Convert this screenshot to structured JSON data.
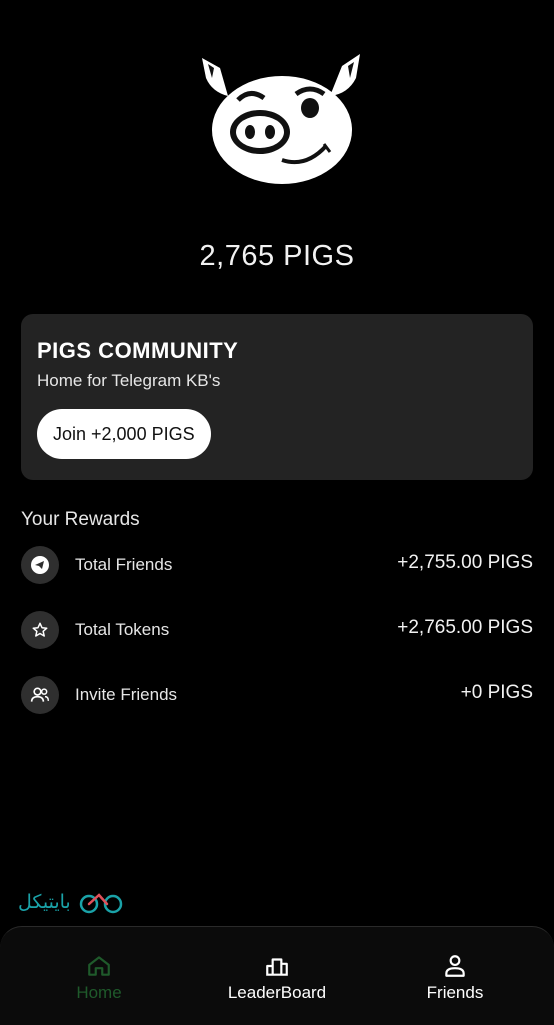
{
  "balance": "2,765 PIGS",
  "community": {
    "title": "PIGS COMMUNITY",
    "subtitle": "Home for Telegram KB's",
    "join_label": "Join +2,000 PIGS"
  },
  "rewards": {
    "title": "Your Rewards",
    "items": [
      {
        "label": "Total Friends",
        "value": "+2,755.00 PIGS",
        "icon": "telegram-icon"
      },
      {
        "label": "Total Tokens",
        "value": "+2,765.00 PIGS",
        "icon": "star-icon"
      },
      {
        "label": "Invite Friends",
        "value": "+0 PIGS",
        "icon": "users-icon"
      }
    ]
  },
  "watermark": {
    "text": "بایتیکل"
  },
  "nav": {
    "items": [
      {
        "label": "Home",
        "icon": "home-icon",
        "active": true
      },
      {
        "label": "LeaderBoard",
        "icon": "leaderboard-icon",
        "active": false
      },
      {
        "label": "Friends",
        "icon": "person-icon",
        "active": false
      }
    ]
  },
  "colors": {
    "background": "#000000",
    "card": "#232323",
    "nav_active": "#1f5a2b",
    "watermark": "#1aa2a8"
  }
}
